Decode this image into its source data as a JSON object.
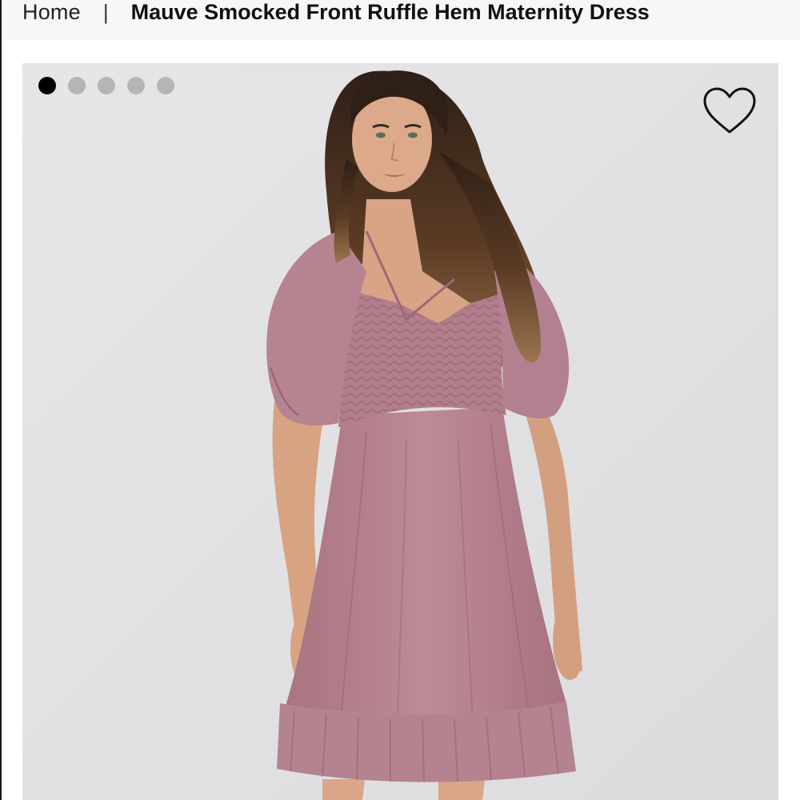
{
  "breadcrumb": {
    "home_label": "Home",
    "separator": "|",
    "current_label": "Mauve Smocked Front Ruffle Hem Maternity Dress"
  },
  "gallery": {
    "image_count": 5,
    "active_index": 0,
    "favorite_icon": "heart-outline-icon"
  },
  "colors": {
    "dress": "#b88594",
    "background": "#e3e3e5",
    "active_dot": "#000000",
    "inactive_dot": "#b5b5b5"
  }
}
